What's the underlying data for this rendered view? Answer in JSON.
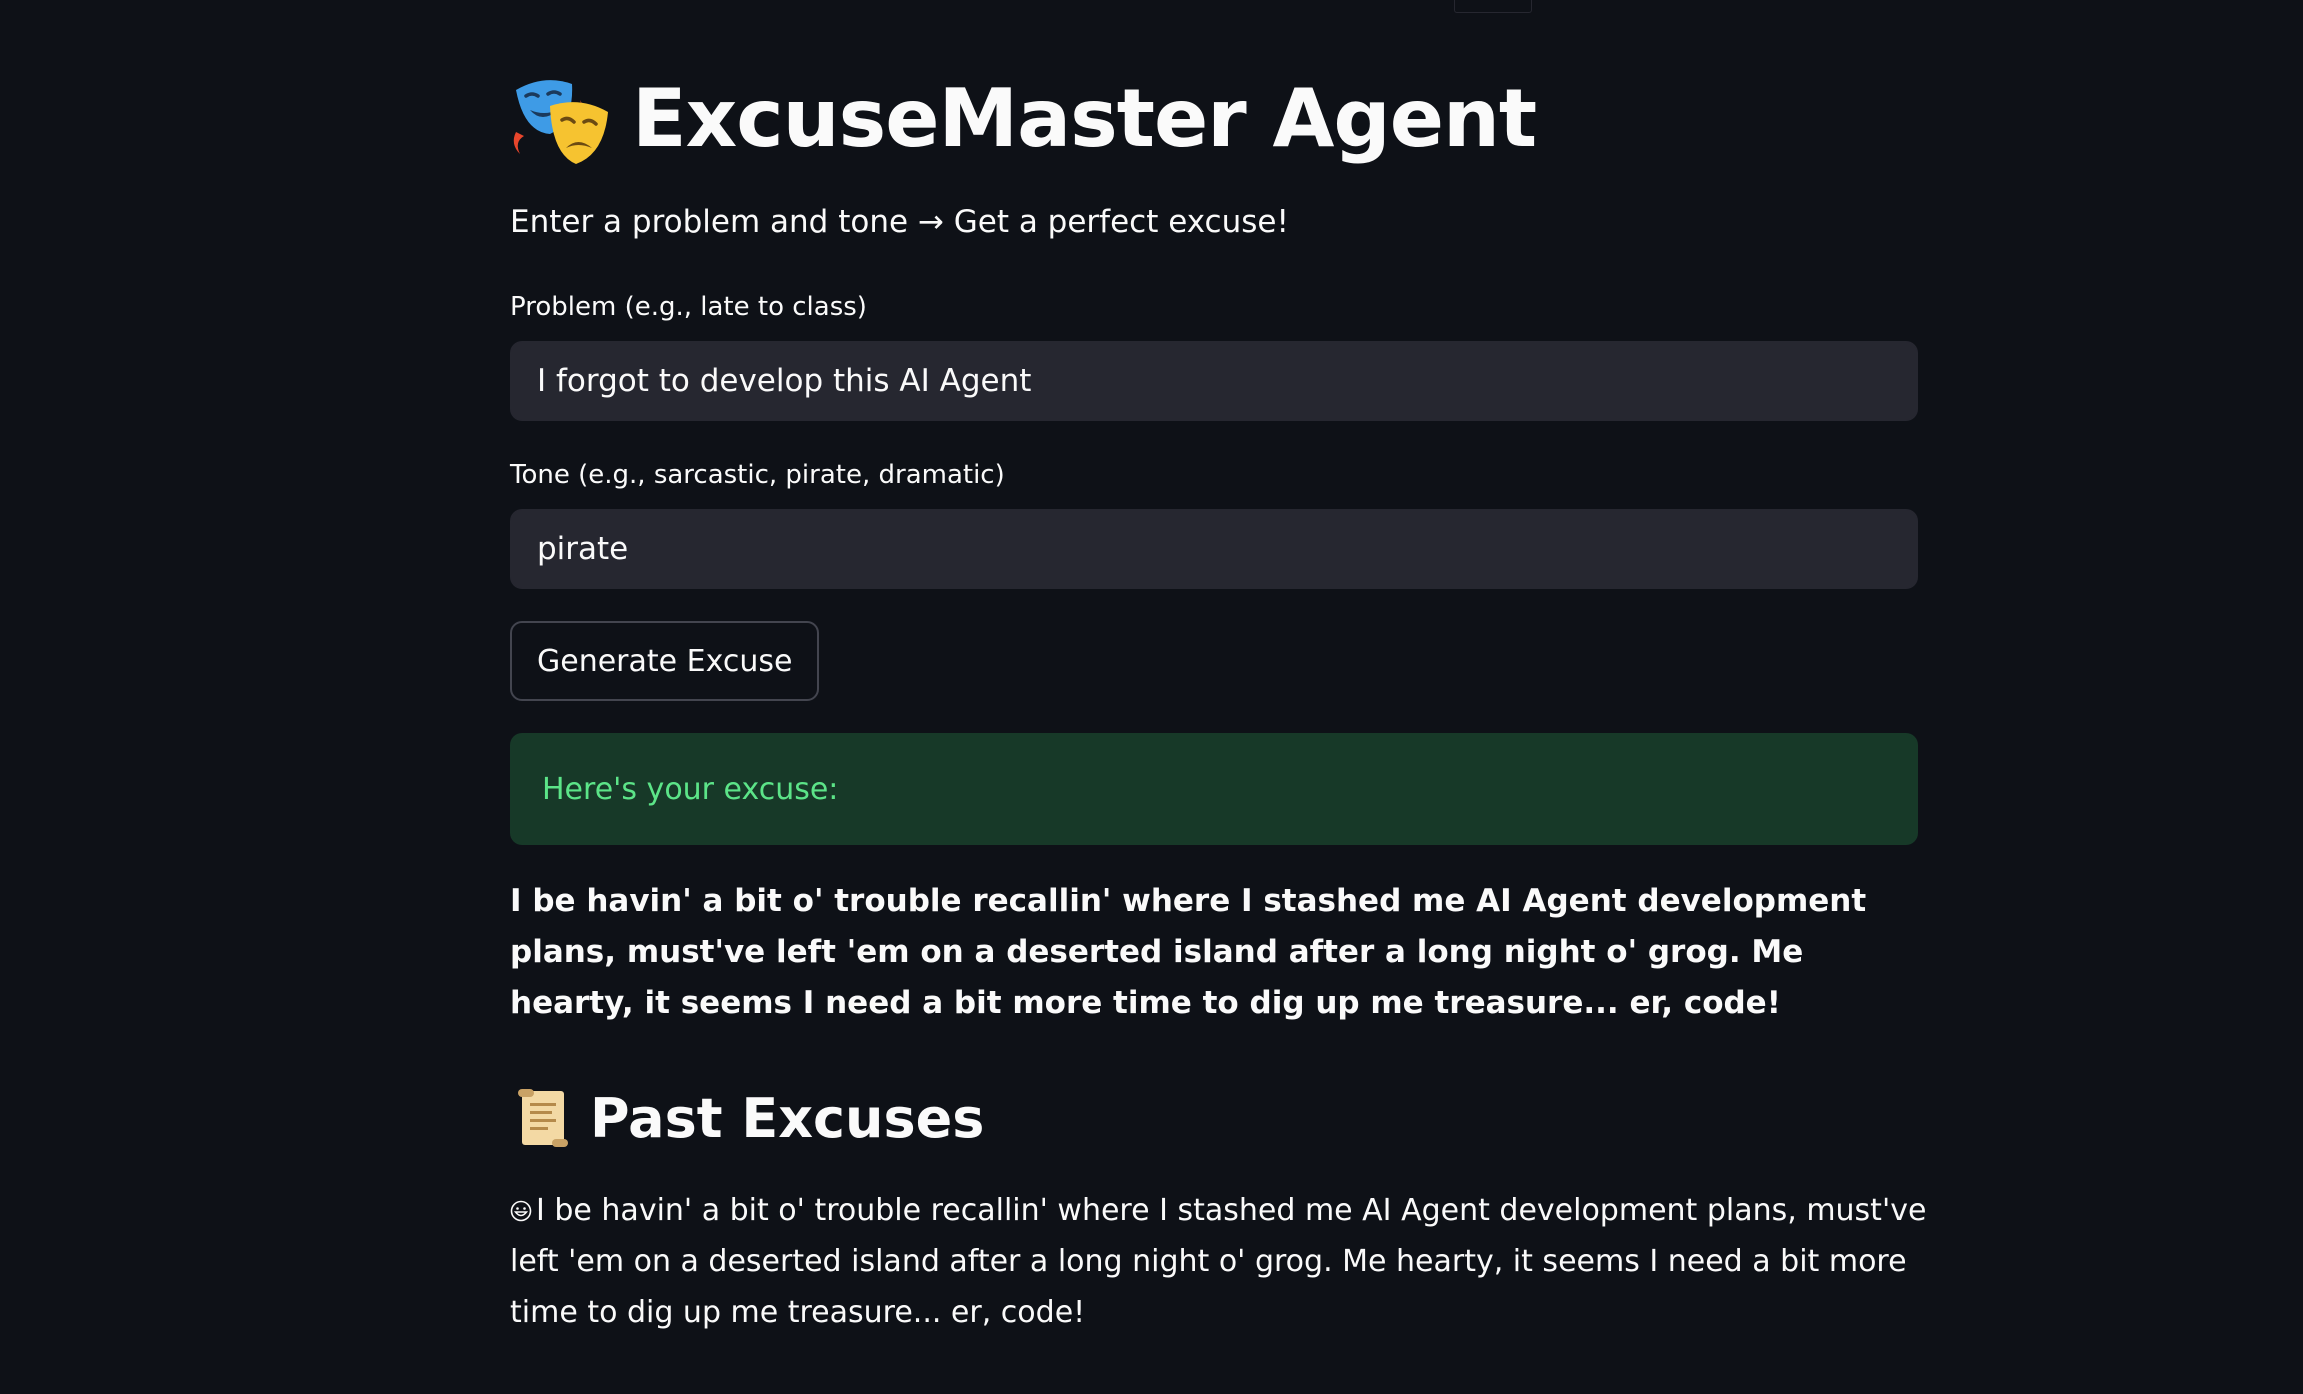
{
  "app": {
    "title": "ExcuseMaster Agent",
    "title_icon": "performing-arts-masks-icon",
    "subtitle": "Enter a problem and tone → Get a perfect excuse!"
  },
  "form": {
    "problem": {
      "label": "Problem (e.g., late to class)",
      "value": "I forgot to develop this AI Agent"
    },
    "tone": {
      "label": "Tone (e.g., sarcastic, pirate, dramatic)",
      "value": "pirate"
    },
    "generate_label": "Generate Excuse"
  },
  "result": {
    "success_label": "Here's your excuse:",
    "excuse": "I be havin' a bit o' trouble recallin' where I stashed me AI Agent development plans, must've left 'em on a deserted island after a long night o' grog. Me hearty, it seems I need a bit more time to dig up me treasure... er, code!"
  },
  "past": {
    "title": "Past Excuses",
    "title_icon": "scroll-icon",
    "items": [
      {
        "icon": "grinning-face-icon",
        "text": "I be havin' a bit o' trouble recallin' where I stashed me AI Agent development plans, must've left 'em on a deserted island after a long night o' grog. Me hearty, it seems I need a bit more time to dig up me treasure... er, code!"
      }
    ]
  },
  "colors": {
    "background": "#0e1117",
    "input_background": "#262730",
    "success_background": "#173928",
    "success_text": "#5ce488",
    "text": "#fafafa"
  }
}
